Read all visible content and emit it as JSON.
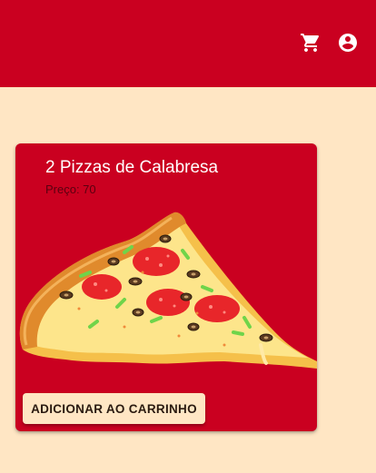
{
  "header": {
    "background_color": "#ca0020",
    "icons": [
      "shopping-cart-icon",
      "account-circle-icon"
    ]
  },
  "page": {
    "background_color": "#ffe6c4"
  },
  "product_card": {
    "title": "2 Pizzas de Calabresa",
    "price_text": "Preço: 70",
    "image": "pepperoni-pizza-slice",
    "add_button_label": "ADICIONAR AO CARRINHO"
  }
}
